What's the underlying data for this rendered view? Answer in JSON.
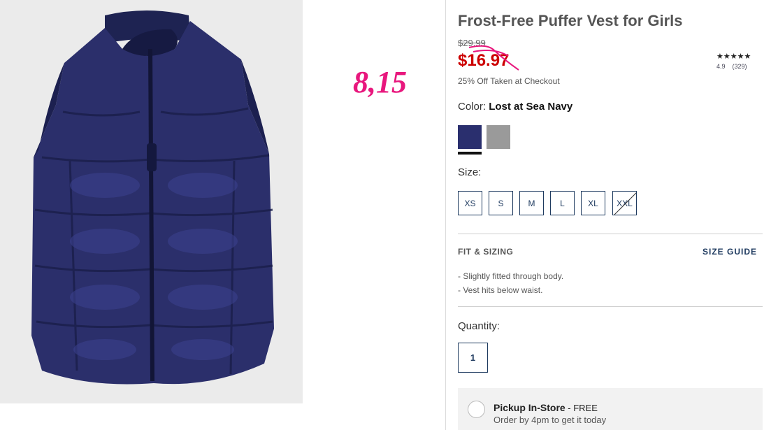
{
  "annotation": "8,15",
  "product": {
    "title": "Frost-Free Puffer Vest for Girls",
    "old_price": "$29.99",
    "sale_price": "$16.97",
    "promo": "25% Off Taken at Checkout",
    "rating": {
      "stars": "★★★★★",
      "score": "4.9",
      "count": "(329)"
    }
  },
  "color": {
    "label": "Color:",
    "selected": "Lost at Sea Navy",
    "swatches": [
      {
        "name": "navy",
        "hex": "#2a2f6e",
        "selected": true
      },
      {
        "name": "grey",
        "hex": "#9a9a9a",
        "selected": false
      }
    ]
  },
  "size": {
    "label": "Size:",
    "options": [
      "XS",
      "S",
      "M",
      "L",
      "XL",
      "XXL"
    ],
    "unavailable": [
      "XXL"
    ]
  },
  "fit": {
    "heading": "FIT & SIZING",
    "guide_link": "SIZE GUIDE",
    "items": [
      "Slightly fitted through body.",
      "Vest hits below waist."
    ]
  },
  "quantity": {
    "label": "Quantity:",
    "value": "1"
  },
  "pickup": {
    "title": "Pickup In-Store",
    "free": " - FREE",
    "subtitle": "Order by 4pm to get it today"
  },
  "colors": {
    "sale": "#cc0000",
    "accent": "#1e3a5f",
    "annotation": "#e8177d"
  }
}
